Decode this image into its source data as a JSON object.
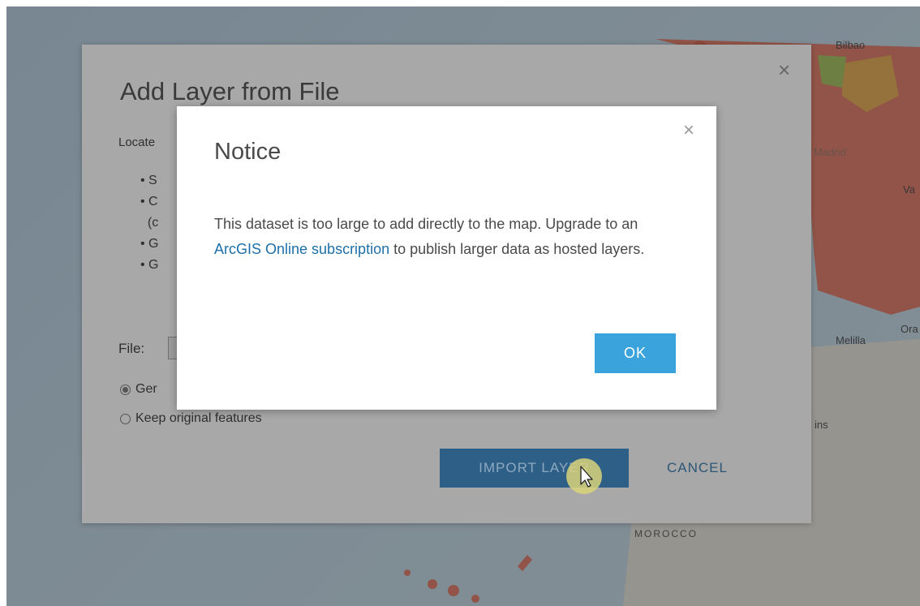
{
  "map": {
    "labels": {
      "bilbao": "Bilbao",
      "madrid": "Madrid",
      "va": "Va",
      "melilla": "Melilla",
      "ora": "Ora",
      "ins": "ins",
      "morocco": "MOROCCO"
    }
  },
  "background_dialog": {
    "title": "Add Layer from File",
    "intro": "Locate",
    "bullets": [
      "S",
      "C",
      "(c",
      "G",
      "G"
    ],
    "file_label": "File:",
    "radio_generalize": "Ger",
    "radio_keep": "Keep original features",
    "import_button": "IMPORT LAYER",
    "cancel_button": "CANCEL",
    "close_glyph": "×"
  },
  "notice": {
    "title": "Notice",
    "body_before": "This dataset is too large to add directly to the map. Upgrade to an ",
    "link_text": "ArcGIS Online subscription",
    "body_after": " to publish larger data as hosted layers.",
    "ok_button": "OK",
    "close_glyph": "×"
  },
  "colors": {
    "accent_button": "#3ba3db",
    "link": "#1d6fa8",
    "import_button_dim": "#2e5f87",
    "cancel_text": "#2b5676"
  }
}
